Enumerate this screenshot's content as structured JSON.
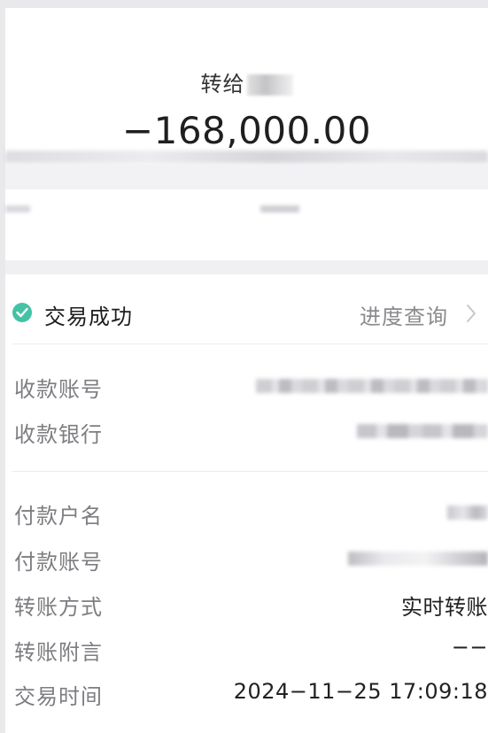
{
  "header": {
    "recipient_prefix": "转给",
    "amount": "−168,000.00"
  },
  "status": {
    "text": "交易成功",
    "progress_link": "进度查询",
    "status_color": "#44c2a5"
  },
  "details": {
    "payee_account_label": "收款账号",
    "payee_bank_label": "收款银行",
    "payer_name_label": "付款户名",
    "payer_account_label": "付款账号",
    "transfer_method_label": "转账方式",
    "transfer_method_value": "实时转账",
    "memo_label": "转账附言",
    "memo_value": "−−",
    "time_label": "交易时间",
    "time_value": "2024−11−25 17:09:18"
  },
  "icons": {
    "status": "check-circle-icon",
    "link": "chevron-right-icon"
  }
}
